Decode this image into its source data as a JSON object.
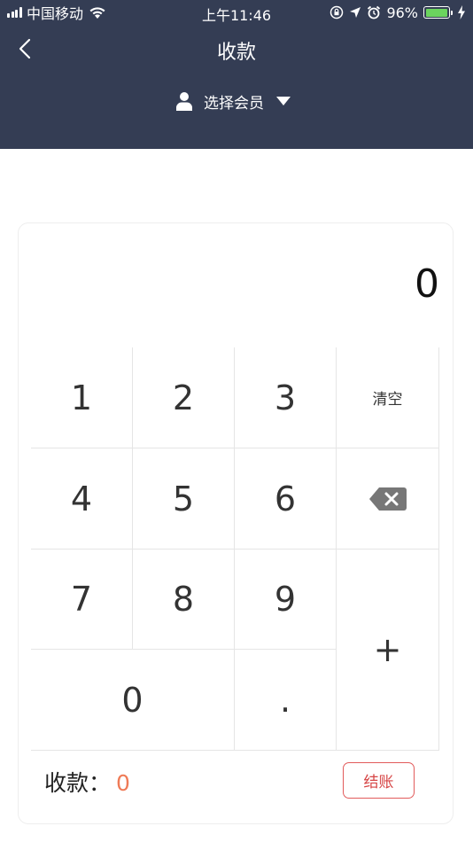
{
  "status_bar": {
    "carrier": "中国移动",
    "time": "上午11:46",
    "battery": "96%",
    "battery_level": 0.96
  },
  "nav": {
    "title": "收款",
    "member_select": "选择会员"
  },
  "display": {
    "amount": "0"
  },
  "keypad": {
    "k1": "1",
    "k2": "2",
    "k3": "3",
    "clear": "清空",
    "k4": "4",
    "k5": "5",
    "k6": "6",
    "k7": "7",
    "k8": "8",
    "k9": "9",
    "k0": "0",
    "dot": ".",
    "plus": "+"
  },
  "footer": {
    "total_label": "收款：",
    "total_value": "0",
    "settle_button": "结账"
  },
  "colors": {
    "header_bg": "#343d54",
    "accent_orange": "#ef7b57",
    "settle_red": "#d64545",
    "battery_green": "#6bd45e"
  },
  "icons": [
    "signal-icon",
    "wifi-icon",
    "orientation-lock-icon",
    "location-icon",
    "alarm-icon",
    "battery-icon",
    "charging-icon",
    "back-chevron-icon",
    "user-icon",
    "caret-down-icon",
    "backspace-icon"
  ]
}
